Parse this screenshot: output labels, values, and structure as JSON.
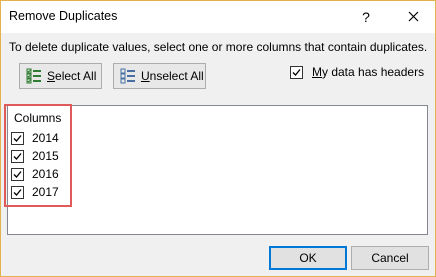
{
  "window": {
    "title": "Remove Duplicates",
    "help_label": "?",
    "close_label": "✕"
  },
  "instruction": "To delete duplicate values, select one or more columns that contain duplicates.",
  "toolbar": {
    "select_all": {
      "mnemonic": "S",
      "rest": "elect All",
      "icon": "select-all-icon"
    },
    "unselect_all": {
      "mnemonic": "U",
      "rest": "nselect All",
      "icon": "unselect-all-icon"
    }
  },
  "headers_checkbox": {
    "mnemonic": "M",
    "rest": "y data has headers",
    "checked": true
  },
  "columns": {
    "header": "Columns",
    "items": [
      {
        "label": "2014",
        "checked": true
      },
      {
        "label": "2015",
        "checked": true
      },
      {
        "label": "2016",
        "checked": true
      },
      {
        "label": "2017",
        "checked": true
      }
    ]
  },
  "footer": {
    "ok_label": "OK",
    "cancel_label": "Cancel"
  },
  "colors": {
    "highlight": "#e05a5a",
    "dialog_bg": "#f0f0f0",
    "accent": "#0078d7"
  }
}
